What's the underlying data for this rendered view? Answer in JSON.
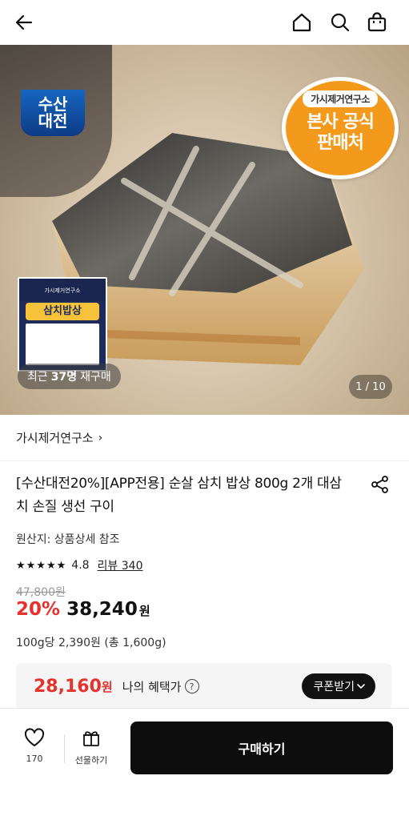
{
  "hero": {
    "brand_logo_line1": "수산",
    "brand_logo_line2": "대전",
    "seal_top": "가시제거연구소",
    "seal_line1": "본사 공식",
    "seal_line2": "판매처",
    "package_top": "가시제거연구소",
    "package_banner": "삼치밥상",
    "repurchase_prefix": "최근",
    "repurchase_count": "37명",
    "repurchase_suffix": "재구매",
    "pager": "1 / 10"
  },
  "store": {
    "name": "가시제거연구소",
    "chevron": "›"
  },
  "product": {
    "title": "[수산대전20%][APP전용] 순살 삼치 밥상 800g 2개 대삼치 손질 생선 구이",
    "origin": "원산지: 상품상세 참조",
    "stars": "★★★★★",
    "rating": "4.8",
    "review_link": "리뷰 340",
    "original_price": "47,800원",
    "discount": "20%",
    "price": "38,240",
    "price_unit": "원",
    "unit_price": "100g당 2,390원 (총 1,600g)"
  },
  "benefit": {
    "price": "28,160",
    "unit": "원",
    "label": "나의 혜택가",
    "help_glyph": "?",
    "coupon_button": "쿠폰받기"
  },
  "bottom": {
    "like_count": "170",
    "gift_label": "선물하기",
    "buy_label": "구매하기"
  },
  "colors": {
    "accent_red": "#e5322d",
    "seal_orange": "#f39a1c",
    "button_dark": "#0d0d0d"
  },
  "icons": [
    "back-arrow-icon",
    "home-icon",
    "search-icon",
    "shopping-bag-icon",
    "share-icon",
    "heart-icon",
    "gift-icon",
    "question-circle-icon",
    "chevron-down-icon"
  ]
}
